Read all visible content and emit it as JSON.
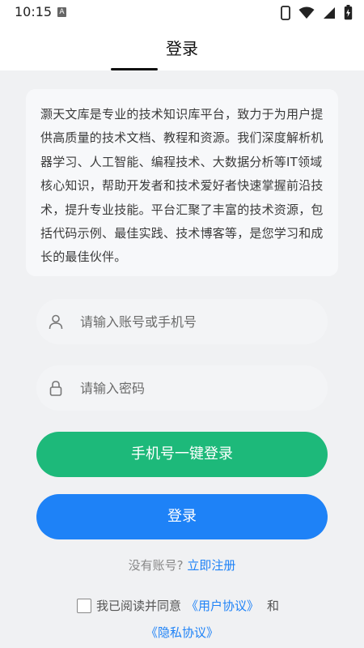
{
  "status_bar": {
    "time": "10:15",
    "notification_icon": "a-icon",
    "icons": [
      "sim-icon",
      "wifi-icon",
      "signal-icon",
      "battery-icon"
    ]
  },
  "header": {
    "title": "登录"
  },
  "intro": {
    "text": "灏天文库是专业的技术知识库平台，致力于为用户提供高质量的技术文档、教程和资源。我们深度解析机器学习、人工智能、编程技术、大数据分析等IT领域核心知识，帮助开发者和技术爱好者快速掌握前沿技术，提升专业技能。平台汇聚了丰富的技术资源，包括代码示例、最佳实践、技术博客等，是您学习和成长的最佳伙伴。"
  },
  "form": {
    "account": {
      "placeholder": "请输入账号或手机号",
      "value": "",
      "icon": "user-icon"
    },
    "password": {
      "placeholder": "请输入密码",
      "value": "",
      "icon": "lock-icon"
    },
    "phone_login_label": "手机号一键登录",
    "login_label": "登录"
  },
  "register": {
    "prompt": "没有账号?",
    "link": "立即注册"
  },
  "agreement": {
    "checked": false,
    "prefix": "我已阅读并同意",
    "user_agreement": "《用户协议》",
    "and": "和",
    "privacy_policy": "《隐私协议》"
  },
  "colors": {
    "primary": "#1e82f7",
    "green": "#1db97a"
  }
}
